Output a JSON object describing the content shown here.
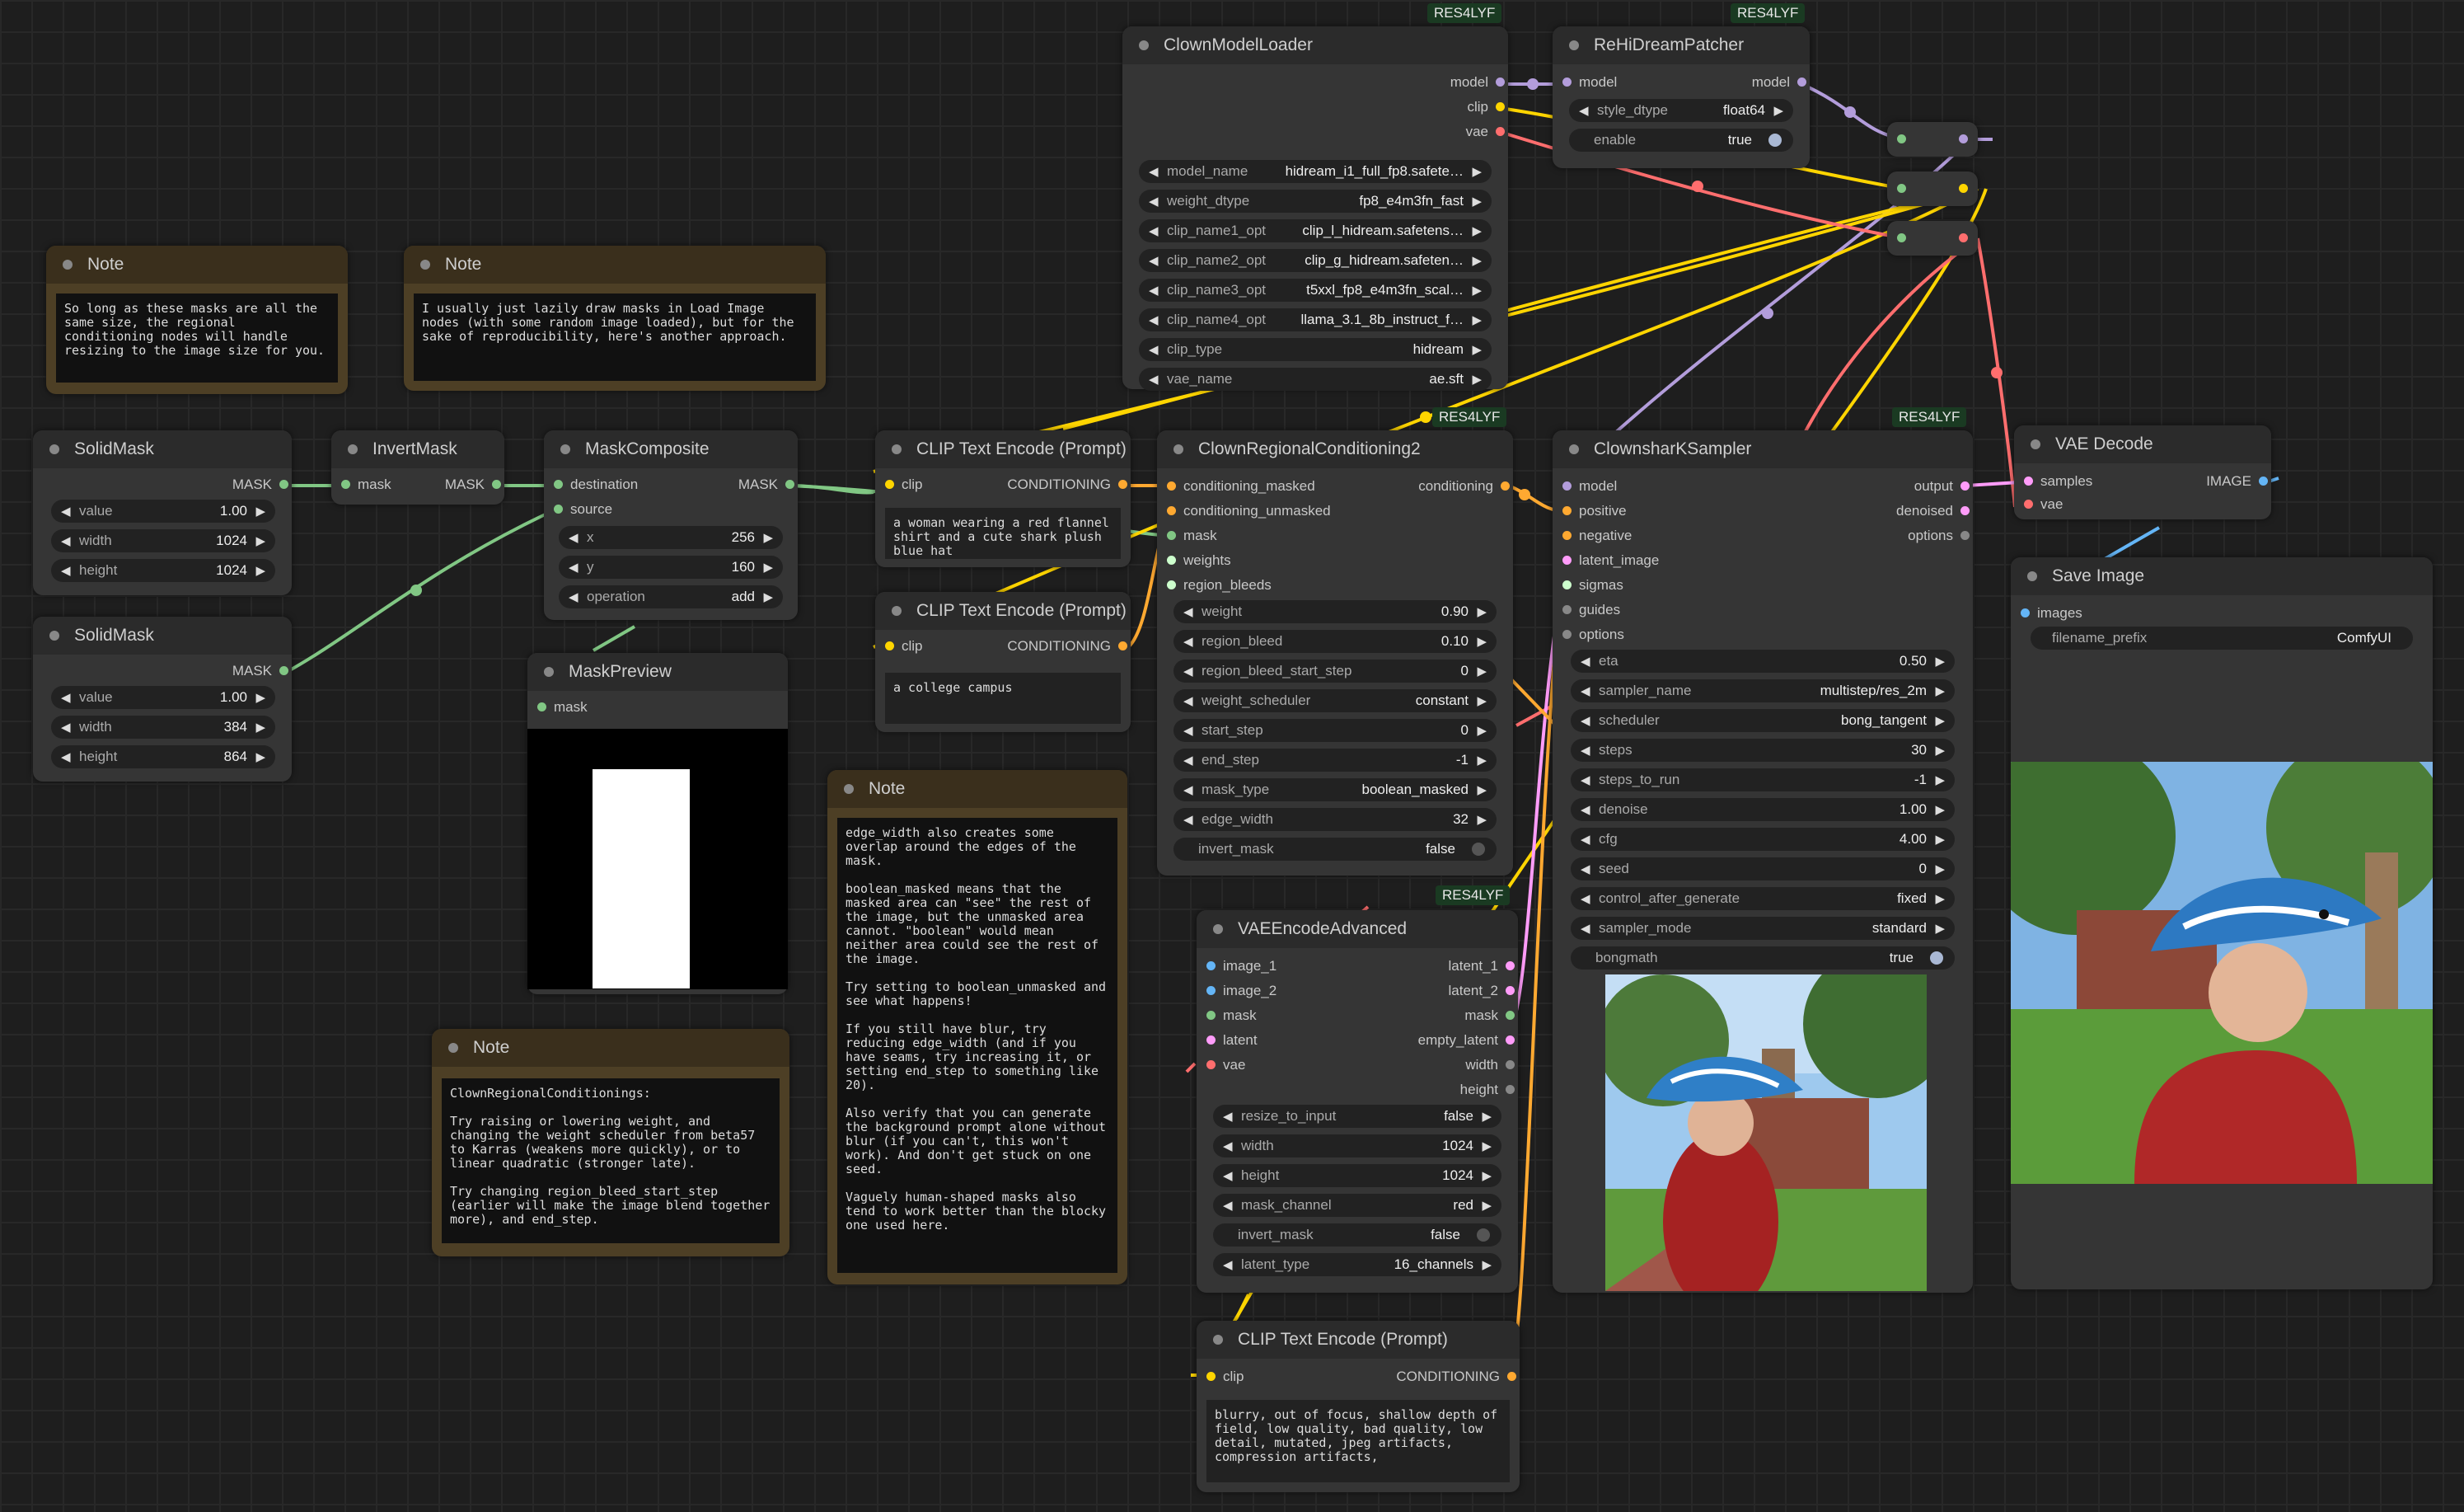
{
  "colors": {
    "model": "#b39ddb",
    "clip": "#ffd500",
    "vae": "#ff6e6e",
    "mask": "#81c784",
    "conditioning": "#ffa931",
    "latent": "#ff9cf9",
    "image": "#64b5f6",
    "sigmas": "#cdffcd",
    "badge": "#1a3a22",
    "canvas": "#1e1e1e",
    "node": "#353535",
    "note": "#4d3f25"
  },
  "badges": {
    "model_loader": "RES4LYF",
    "patcher": "RES4LYF",
    "regional": "RES4LYF",
    "sampler": "RES4LYF",
    "vae_encode": "RES4LYF"
  },
  "notes": {
    "note1": {
      "title": "Note",
      "text": "So long as these masks are all the same size, the regional conditioning nodes will handle resizing to the image size for you."
    },
    "note2": {
      "title": "Note",
      "text": "I usually just lazily draw masks in Load Image nodes (with some random image loaded), but for the sake of reproducibility, here's another approach."
    },
    "note3": {
      "title": "Note",
      "text": "edge_width also creates some overlap around the edges of the mask.\n\nboolean_masked means that the masked area can \"see\" the rest of the image, but the unmasked area cannot. \"boolean\" would mean neither area could see the rest of the image.\n\nTry setting to boolean_unmasked and see what happens!\n\nIf you still have blur, try reducing edge_width (and if you have seams, try increasing it, or setting end_step to something like 20).\n\nAlso verify that you can generate the background prompt alone without blur (if you can't, this won't work). And don't get stuck on one seed.\n\nVaguely human-shaped masks also tend to work better than the blocky one used here."
    },
    "note4": {
      "title": "Note",
      "text": "ClownRegionalConditionings:\n\nTry raising or lowering weight, and changing the weight scheduler from beta57 to Karras (weakens more quickly), or to linear quadratic (stronger late).\n\nTry changing region_bleed_start_step (earlier will make the image blend together more), and end_step."
    }
  },
  "solid1": {
    "title": "SolidMask",
    "out": "MASK",
    "value_l": "value",
    "value_v": "1.00",
    "width_l": "width",
    "width_v": "1024",
    "height_l": "height",
    "height_v": "1024"
  },
  "solid2": {
    "title": "SolidMask",
    "out": "MASK",
    "value_l": "value",
    "value_v": "1.00",
    "width_l": "width",
    "width_v": "384",
    "height_l": "height",
    "height_v": "864"
  },
  "invert": {
    "title": "InvertMask",
    "in": "mask",
    "out": "MASK"
  },
  "composite": {
    "title": "MaskComposite",
    "in1": "destination",
    "in2": "source",
    "out": "MASK",
    "x_l": "x",
    "x_v": "256",
    "y_l": "y",
    "y_v": "160",
    "op_l": "operation",
    "op_v": "add"
  },
  "preview": {
    "title": "MaskPreview",
    "in": "mask"
  },
  "clip1": {
    "title": "CLIP Text Encode (Prompt)",
    "in": "clip",
    "out": "CONDITIONING",
    "text": "a woman wearing a red flannel shirt and a cute shark plush blue hat"
  },
  "clip2": {
    "title": "CLIP Text Encode (Prompt)",
    "in": "clip",
    "out": "CONDITIONING",
    "text": "a college campus"
  },
  "clip3": {
    "title": "CLIP Text Encode (Prompt)",
    "in": "clip",
    "out": "CONDITIONING",
    "text": "blurry, out of focus, shallow depth of field, low quality, bad quality, low detail, mutated, jpeg artifacts, compression artifacts,"
  },
  "loader": {
    "title": "ClownModelLoader",
    "outs": [
      "model",
      "clip",
      "vae"
    ],
    "widgets": [
      {
        "l": "model_name",
        "v": "hidream_i1_full_fp8.safete…"
      },
      {
        "l": "weight_dtype",
        "v": "fp8_e4m3fn_fast"
      },
      {
        "l": "clip_name1_opt",
        "v": "clip_l_hidream.safetens…"
      },
      {
        "l": "clip_name2_opt",
        "v": "clip_g_hidream.safeten…"
      },
      {
        "l": "clip_name3_opt",
        "v": "t5xxl_fp8_e4m3fn_scal…"
      },
      {
        "l": "clip_name4_opt",
        "v": "llama_3.1_8b_instruct_f…"
      },
      {
        "l": "clip_type",
        "v": "hidream"
      },
      {
        "l": "vae_name",
        "v": "ae.sft"
      }
    ]
  },
  "patcher": {
    "title": "ReHiDreamPatcher",
    "in": "model",
    "out": "model",
    "dtype_l": "style_dtype",
    "dtype_v": "float64",
    "enable_l": "enable",
    "enable_v": "true"
  },
  "regional": {
    "title": "ClownRegionalConditioning2",
    "ins": [
      "conditioning_masked",
      "conditioning_unmasked",
      "mask",
      "weights",
      "region_bleeds"
    ],
    "out": "conditioning",
    "widgets": [
      {
        "l": "weight",
        "v": "0.90"
      },
      {
        "l": "region_bleed",
        "v": "0.10"
      },
      {
        "l": "region_bleed_start_step",
        "v": "0"
      },
      {
        "l": "weight_scheduler",
        "v": "constant"
      },
      {
        "l": "start_step",
        "v": "0"
      },
      {
        "l": "end_step",
        "v": "-1"
      },
      {
        "l": "mask_type",
        "v": "boolean_masked"
      },
      {
        "l": "edge_width",
        "v": "32"
      }
    ],
    "invert_l": "invert_mask",
    "invert_v": "false"
  },
  "sampler": {
    "title": "ClownsharKSampler",
    "ins": [
      "model",
      "positive",
      "negative",
      "latent_image",
      "sigmas",
      "guides",
      "options"
    ],
    "outs": [
      "output",
      "denoised",
      "options"
    ],
    "widgets": [
      {
        "l": "eta",
        "v": "0.50"
      },
      {
        "l": "sampler_name",
        "v": "multistep/res_2m"
      },
      {
        "l": "scheduler",
        "v": "bong_tangent"
      },
      {
        "l": "steps",
        "v": "30"
      },
      {
        "l": "steps_to_run",
        "v": "-1"
      },
      {
        "l": "denoise",
        "v": "1.00"
      },
      {
        "l": "cfg",
        "v": "4.00"
      },
      {
        "l": "seed",
        "v": "0"
      },
      {
        "l": "control_after_generate",
        "v": "fixed"
      },
      {
        "l": "sampler_mode",
        "v": "standard"
      }
    ],
    "bongmath_l": "bongmath",
    "bongmath_v": "true"
  },
  "vaeenc": {
    "title": "VAEEncodeAdvanced",
    "ins": [
      "image_1",
      "image_2",
      "mask",
      "latent",
      "vae"
    ],
    "outs": [
      "latent_1",
      "latent_2",
      "mask",
      "empty_latent",
      "width",
      "height"
    ],
    "resize_l": "resize_to_input",
    "resize_v": "false",
    "width_l": "width",
    "width_v": "1024",
    "height_l": "height",
    "height_v": "1024",
    "channel_l": "mask_channel",
    "channel_v": "red",
    "invert_l": "invert_mask",
    "invert_v": "false",
    "latent_l": "latent_type",
    "latent_v": "16_channels"
  },
  "vaedec": {
    "title": "VAE Decode",
    "in1": "samples",
    "in2": "vae",
    "out": "IMAGE"
  },
  "save": {
    "title": "Save Image",
    "in": "images",
    "prefix_l": "filename_prefix",
    "prefix_v": "ComfyUI"
  },
  "reroute": {}
}
